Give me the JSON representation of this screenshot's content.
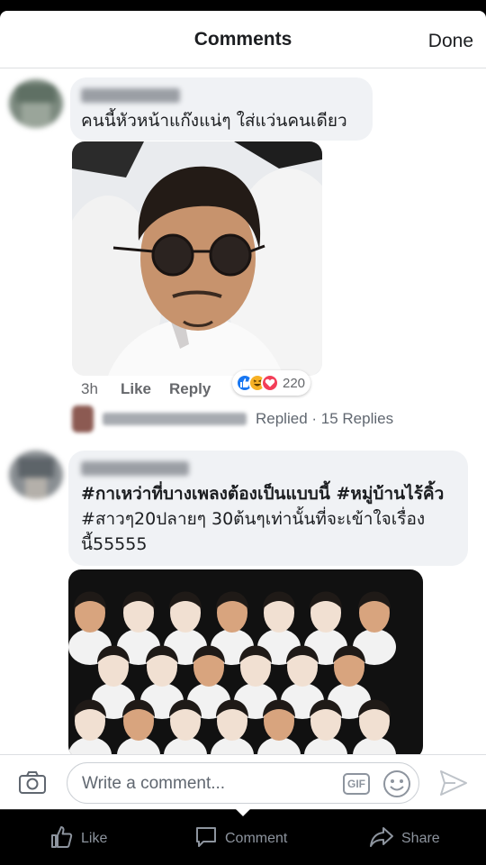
{
  "header": {
    "title": "Comments",
    "done_label": "Done"
  },
  "comments": [
    {
      "text_line1": "คนนี้หัวหน้าแก๊งแน่ๆ ใส่แว่นคนเดียว",
      "time": "3h",
      "like_label": "Like",
      "reply_label": "Reply",
      "reactions": [
        "like",
        "haha",
        "love"
      ],
      "reaction_count": "220",
      "replies_summary": "Replied · 15 Replies"
    },
    {
      "line1": "#กาเหว่าที่บางเพลงต้องเป็นแบบนี้ #หมู่บ้านไร้คิ้ว",
      "line2": "#สาวๆ20ปลายๆ 30ต้นๆเท่านั้นที่จะเข้าใจเรื่อง",
      "line3": "นี้55555"
    }
  ],
  "composer": {
    "placeholder": "Write a comment...",
    "gif_label": "GIF"
  },
  "bottom_bar": {
    "like_label": "Like",
    "comment_label": "Comment",
    "share_label": "Share"
  },
  "colors": {
    "accent_blue": "#1877f2",
    "bubble_bg": "#f0f2f5",
    "muted_text": "#65676b",
    "love_red": "#f33e58",
    "haha_yellow": "#f7b125"
  },
  "icons": [
    "camera-icon",
    "emoji-icon",
    "send-icon",
    "like-icon",
    "comment-icon",
    "share-icon"
  ]
}
